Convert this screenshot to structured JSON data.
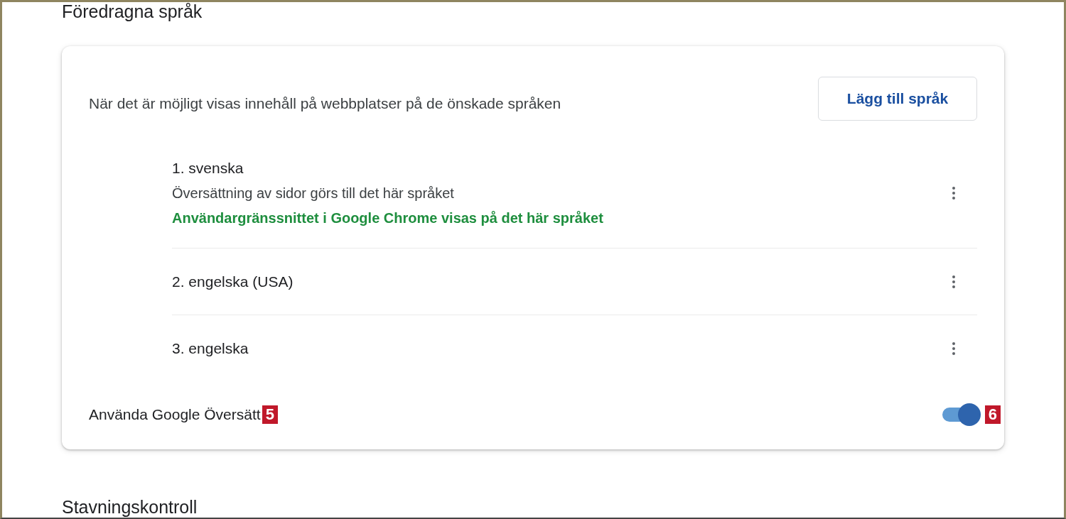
{
  "section_title": "Föredragna språk",
  "card": {
    "description": "När det är möjligt visas innehåll på webbplatser på de önskade språken",
    "add_button": "Lägg till språk",
    "languages": [
      {
        "name": "1. svenska",
        "notes": [
          {
            "kind": "plain",
            "text": "Översättning av sidor görs till det här språket"
          },
          {
            "kind": "ui",
            "text": "Användargränssnittet i Google Chrome visas på det här språket"
          }
        ]
      },
      {
        "name": "2. engelska (USA)"
      },
      {
        "name": "3. engelska"
      }
    ],
    "translate": {
      "label": "Använda Google Översätt",
      "label_badge": "5",
      "on": true,
      "toggle_badge": "6"
    }
  },
  "next_section_title": "Stavningskontroll"
}
